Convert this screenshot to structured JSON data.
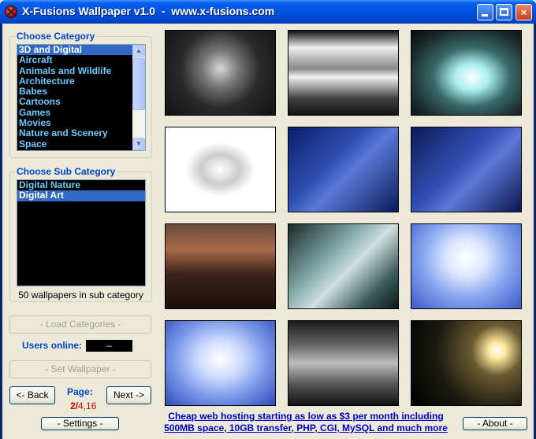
{
  "window": {
    "title": "X-Fusions Wallpaper v1.0  -  www.x-fusions.com",
    "controls": {
      "minimize": "minimize",
      "maximize": "maximize",
      "close": "×"
    }
  },
  "category": {
    "title": "Choose Category",
    "items": [
      "3D and Digital",
      "Aircraft",
      "Animals and Wildlife",
      "Architecture",
      "Babes",
      "Cartoons",
      "Games",
      "Movies",
      "Nature and Scenery",
      "Space"
    ],
    "selected_index": 0,
    "scroll_up_icon": "▲",
    "scroll_down_icon": "▼"
  },
  "subcategory": {
    "title": "Choose Sub Category",
    "items": [
      "Digital Nature",
      "Digital Art"
    ],
    "selected_index": 1,
    "count_text": "50 wallpapers in sub category"
  },
  "controls": {
    "load_categories": "- Load Categories -",
    "users_online_label": "Users online:",
    "users_online_value": "–",
    "set_wallpaper": "- Set Wallpaper -",
    "back": "<- Back",
    "next": "Next ->",
    "page_label": "Page:",
    "page_current": "2",
    "page_sep": "/",
    "page_total": "4,16",
    "settings": "- Settings -",
    "about": "- About -"
  },
  "ad": {
    "line1": "Cheap web hosting starting as low as $3 per month including",
    "line2": "500MB space, 10GB transfer, PHP, CGI, MySQL and much more"
  },
  "thumbnails": [
    {
      "name": "gas-mask",
      "bg": "radial-gradient(circle at 50% 45%, #d8d8d8 0%, #777 25%, #2a2a2a 55%, #111 100%)"
    },
    {
      "name": "skull-panorama",
      "bg": "linear-gradient(180deg, #111 0%, #eee 20%, #888 45%, #f2f2f2 55%, #444 80%, #111 100%)"
    },
    {
      "name": "cyan-tech",
      "bg": "radial-gradient(ellipse at 55% 55%, #fff 0%, #aee 20%, #3a6a6a 45%, #1b2a2a 75%, #0a0a0a 100%)"
    },
    {
      "name": "chrome-logo",
      "bg": "radial-gradient(ellipse at 50% 50%, #fff 0%, #ccc 25%, #fff 45%, #fff 100%)"
    },
    {
      "name": "as5-proteus-1",
      "bg": "linear-gradient(135deg, #0a1f6a 0%, #2e4fb0 40%, #5a7ad8 55%, #0a1a5a 100%)"
    },
    {
      "name": "as5-proteus-2",
      "bg": "linear-gradient(135deg, #0d1a55 0%, #3352b8 45%, #5d78d4 60%, #0a1650 100%)"
    },
    {
      "name": "mech-sunset",
      "bg": "linear-gradient(180deg, #6a4a3a 0%, #a86a4a 30%, #3a2218 60%, #1a0e08 100%)"
    },
    {
      "name": "phasefilter",
      "bg": "linear-gradient(135deg, #1a2a2a 0%, #7aa0a0 35%, #cfe0e0 55%, #3a5a5a 80%, #0a1a1a 100%)"
    },
    {
      "name": "blue-glow-pod-1",
      "bg": "radial-gradient(ellipse at 50% 40%, #fff 0%, #dde8ff 25%, #8aa8f0 55%, #3a5ac8 100%)"
    },
    {
      "name": "blue-glow-pod-2",
      "bg": "radial-gradient(ellipse at 50% 45%, #fff 0%, #cfdcff 28%, #7a98e8 60%, #2f4cb8 100%)"
    },
    {
      "name": "android-figure",
      "bg": "linear-gradient(180deg, #1a1a1a 0%, #6a6a6a 30%, #bdbdbd 50%, #555 75%, #111 100%)"
    },
    {
      "name": "spaceship-light",
      "bg": "radial-gradient(circle at 78% 35%, #fff 0%, #ffe9a0 8%, #6a5a30 25%, #1a1a10 60%, #000 100%)"
    }
  ]
}
